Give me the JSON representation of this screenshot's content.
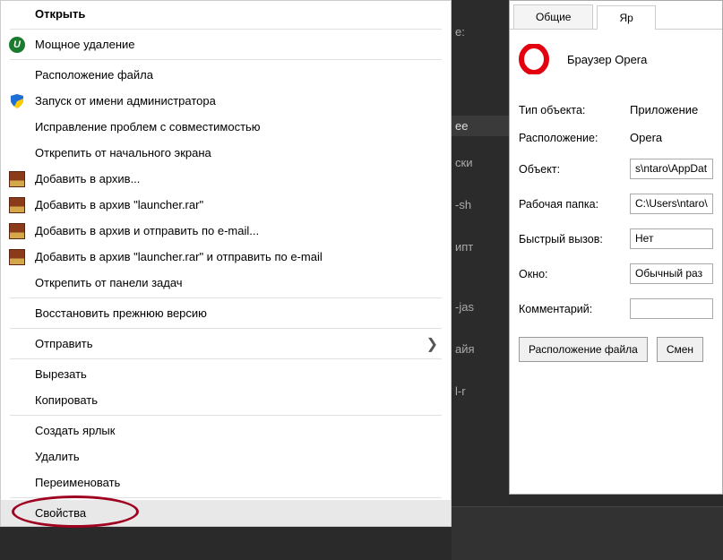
{
  "context_menu": {
    "open": "Открыть",
    "iobit": "Мощное удаление",
    "location": "Расположение файла",
    "run_admin": "Запуск от имени администратора",
    "compat": "Исправление проблем с совместимостью",
    "unpin_start": "Открепить от начального экрана",
    "archive_add": "Добавить в архив...",
    "archive_rar": "Добавить в архив \"launcher.rar\"",
    "archive_email": "Добавить в архив и отправить по e-mail...",
    "archive_rar_email": "Добавить в архив \"launcher.rar\" и отправить по e-mail",
    "unpin_taskbar": "Открепить от панели задач",
    "restore": "Восстановить прежнюю версию",
    "send_to": "Отправить",
    "cut": "Вырезать",
    "copy": "Копировать",
    "create_shortcut": "Создать ярлык",
    "delete": "Удалить",
    "rename": "Переименовать",
    "properties": "Свойства"
  },
  "background_fragments": {
    "f1": "е:",
    "f2": "ее",
    "f3": "ски",
    "f4": "-sh",
    "f5": "ипт",
    "f6": "-jas",
    "f7": "айя",
    "f8": "l-r"
  },
  "properties_dialog": {
    "tab_general": "Общие",
    "tab_shortcut": "Яр",
    "app_name": "Браузер Opera",
    "type_label": "Тип объекта:",
    "type_value": "Приложение",
    "location_label": "Расположение:",
    "location_value": "Opera",
    "target_label": "Объект:",
    "target_value": "s\\ntaro\\AppDat",
    "workdir_label": "Рабочая папка:",
    "workdir_value": "C:\\Users\\ntaro\\",
    "hotkey_label": "Быстрый вызов:",
    "hotkey_value": "Нет",
    "window_label": "Окно:",
    "window_value": "Обычный раз",
    "comment_label": "Комментарий:",
    "comment_value": "",
    "btn_location": "Расположение файла",
    "btn_change": "Смен"
  }
}
